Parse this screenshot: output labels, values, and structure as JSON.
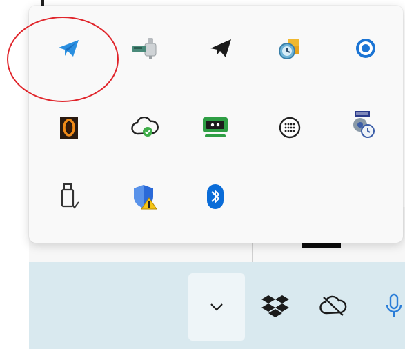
{
  "tray_overflow": {
    "icons": [
      {
        "name": "telegram-desktop-icon",
        "color": "#2a8fe0"
      },
      {
        "name": "usb-network-adapter-icon",
        "color": "#4a8a7a"
      },
      {
        "name": "telegram-black-icon",
        "color": "#1b1b1b"
      },
      {
        "name": "clock-sync-icon",
        "color": "#f0b830"
      },
      {
        "name": "blue-ring-icon",
        "color": "#1b74d4"
      },
      {
        "name": "orange-ring-app-icon",
        "color": "#e07a10"
      },
      {
        "name": "cloud-check-icon",
        "color": "#3fae49"
      },
      {
        "name": "remote-session-icon",
        "color": "#2e9e44"
      },
      {
        "name": "keypad-grid-icon",
        "color": "#222222"
      },
      {
        "name": "dsx-disk-clock-icon",
        "color": "#3c5ea8"
      },
      {
        "name": "safely-remove-usb-icon",
        "color": "#333333"
      },
      {
        "name": "windows-security-warning-icon",
        "color": "#2b6ad8"
      },
      {
        "name": "bluetooth-icon",
        "color": "#0a6cd8"
      }
    ],
    "highlight_color": "#e0252b"
  },
  "taskbar": {
    "icons": [
      {
        "name": "chevron-down-icon"
      },
      {
        "name": "dropbox-icon"
      },
      {
        "name": "cloud-offline-icon"
      },
      {
        "name": "microphone-icon",
        "color": "#2a7dd8"
      }
    ],
    "background": "#d9e9ef"
  }
}
